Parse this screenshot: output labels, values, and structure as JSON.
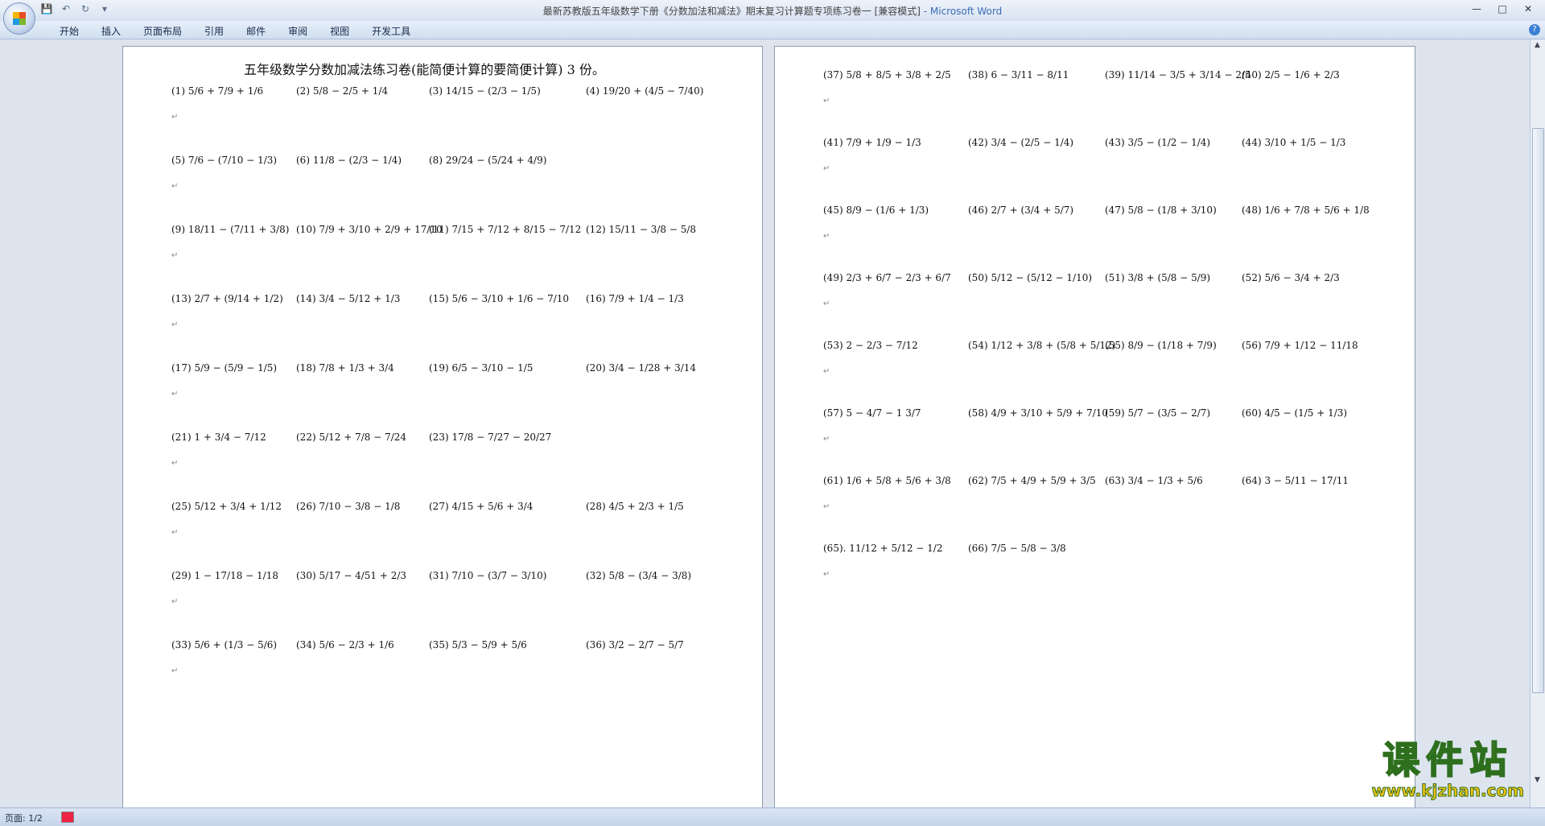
{
  "window": {
    "title": "最新苏教版五年级数学下册《分数加法和减法》期末复习计算题专项练习卷一 [兼容模式] - Microsoft Word",
    "title_doc": "最新苏教版五年级数学下册《分数加法和减法》期末复习计算题专项练习卷一 [兼容模式]",
    "title_app": " - Microsoft Word"
  },
  "quick_access": [
    "save-icon",
    "undo-icon",
    "redo-icon",
    "customize-icon"
  ],
  "ribbon_tabs": [
    "开始",
    "插入",
    "页面布局",
    "引用",
    "邮件",
    "审阅",
    "视图",
    "开发工具"
  ],
  "document": {
    "title": "五年级数学分数加减法练习卷",
    "title_note": "(能简便计算的要简便计算) 3 份。",
    "page1_problems": [
      "(1) 5/6 + 7/9 + 1/6",
      "(2) 5/8 − 2/5 + 1/4",
      "(3) 14/15 − (2/3 − 1/5)",
      "(4) 19/20 + (4/5 − 7/40)",
      "(5) 7/6 − (7/10 − 1/3)",
      "(6) 11/8 − (2/3 − 1/4)",
      "(8) 29/24 − (5/24 + 4/9)",
      "(9) 18/11 − (7/11 + 3/8)",
      "(10) 7/9 + 3/10 + 2/9 + 17/10",
      "(11) 7/15 + 7/12 + 8/15 − 7/12",
      "(12) 15/11 − 3/8 − 5/8",
      "(13) 2/7 + (9/14 + 1/2)",
      "(14) 3/4 − 5/12 + 1/3",
      "(15) 5/6 − 3/10 + 1/6 − 7/10",
      "(16) 7/9 + 1/4 − 1/3",
      "(17) 5/9 − (5/9 − 1/5)",
      "(18) 7/8 + 1/3 + 3/4",
      "(19) 6/5 − 3/10 − 1/5",
      "(20) 3/4 − 1/28 + 3/14",
      "(21) 1 + 3/4 − 7/12",
      "(22) 5/12 + 7/8 − 7/24",
      "(23) 17/8 − 7/27 − 20/27",
      "(25) 5/12 + 3/4 + 1/12",
      "(26) 7/10 − 3/8 − 1/8",
      "(27) 4/15 + 5/6 + 3/4",
      "(28) 4/5 + 2/3 + 1/5",
      "(29) 1 − 17/18 − 1/18",
      "(30) 5/17 − 4/51 + 2/3",
      "(31) 7/10 − (3/7 − 3/10)",
      "(32) 5/8 − (3/4 − 3/8)",
      "(33) 5/6 + (1/3 − 5/6)",
      "(34) 5/6 − 2/3 + 1/6",
      "(35) 5/3 − 5/9 + 5/6",
      "(36) 3/2 − 2/7 − 5/7"
    ],
    "page2_problems": [
      "(37) 5/8 + 8/5 + 3/8 + 2/5",
      "(38) 6 − 3/11 − 8/11",
      "(39) 11/14 − 3/5 + 3/14 − 2/5",
      "(40) 2/5 − 1/6 + 2/3",
      "(41) 7/9 + 1/9 − 1/3",
      "(42) 3/4 − (2/5 − 1/4)",
      "(43) 3/5 − (1/2 − 1/4)",
      "(44) 3/10 + 1/5 − 1/3",
      "(45) 8/9 − (1/6 + 1/3)",
      "(46) 2/7 + (3/4 + 5/7)",
      "(47) 5/8 − (1/8 + 3/10)",
      "(48) 1/6 + 7/8 + 5/6 + 1/8",
      "(49) 2/3 + 6/7 − 2/3 + 6/7",
      "(50) 5/12 − (5/12 − 1/10)",
      "(51) 3/8 + (5/8 − 5/9)",
      "(52) 5/6 − 3/4 + 2/3",
      "(53) 2 − 2/3 − 7/12",
      "(54) 1/12 + 3/8 + (5/8 + 5/12)",
      "(55) 8/9 − (1/18 + 7/9)",
      "(56) 7/9 + 1/12 − 11/18",
      "(57) 5 − 4/7 − 1 3/7",
      "(58) 4/9 + 3/10 + 5/9 + 7/10",
      "(59) 5/7 − (3/5 − 2/7)",
      "(60) 4/5 − (1/5 + 1/3)",
      "(61) 1/6 + 5/8 + 5/6 + 3/8",
      "(62) 7/5 + 4/9 + 5/9 + 3/5",
      "(63) 3/4 − 1/3 + 5/6",
      "(64) 3 − 5/11 − 17/11",
      "(65). 11/12 + 5/12 − 1/2",
      "(66) 7/5 − 5/8 − 3/8"
    ]
  },
  "status": {
    "page": "页面: 1/2"
  },
  "watermark": {
    "text": "课件站",
    "url": "www.kjzhan.com"
  }
}
